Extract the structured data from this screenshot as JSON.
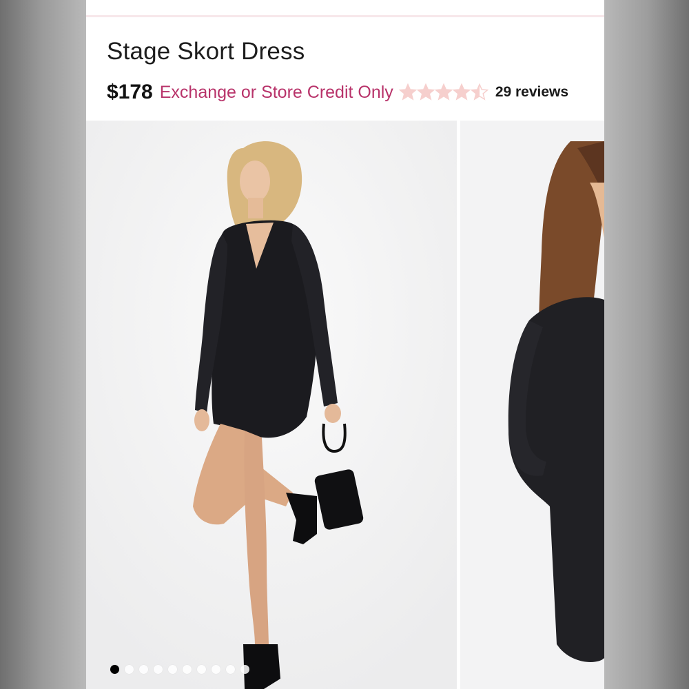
{
  "product": {
    "title": "Stage Skort Dress",
    "price": "$178",
    "policy": "Exchange or Store Credit Only",
    "rating": 4.5,
    "rating_max": 5,
    "reviews": "29 reviews"
  },
  "colors": {
    "policy_text": "#b8336a",
    "star_fill": "#f6cfcd",
    "page_background": "#ffffff"
  },
  "gallery": {
    "image_count": 10,
    "active_index": 0,
    "slides": [
      {
        "icon": "model-photo-front-view"
      },
      {
        "icon": "model-photo-side-view"
      }
    ]
  }
}
